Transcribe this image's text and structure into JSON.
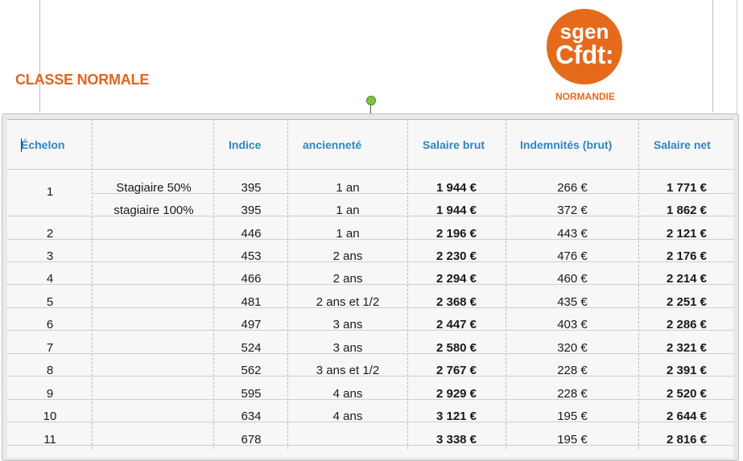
{
  "heading": "CLASSE NORMALE",
  "logo": {
    "line1": "sgen",
    "line2": "Cfdt:",
    "region": "NORMANDIE",
    "color": "#e56a1c"
  },
  "columns": [
    "Échelon",
    "",
    "Indice",
    "ancienneté",
    "Salaire brut",
    "Indemnités (brut)",
    "Salaire net"
  ],
  "rows": [
    {
      "echelon": "1",
      "note": "Stagiaire 50%",
      "indice": "395",
      "anciennete": "1 an",
      "brut": "1 944 €",
      "indemnites": "266 €",
      "net": "1 771 €"
    },
    {
      "echelon": "",
      "note": "stagiaire 100%",
      "indice": "395",
      "anciennete": "1 an",
      "brut": "1 944 €",
      "indemnites": "372 €",
      "net": "1 862 €"
    },
    {
      "echelon": "2",
      "note": "",
      "indice": "446",
      "anciennete": "1 an",
      "brut": "2 196 €",
      "indemnites": "443 €",
      "net": "2 121 €"
    },
    {
      "echelon": "3",
      "note": "",
      "indice": "453",
      "anciennete": "2 ans",
      "brut": "2 230 €",
      "indemnites": "476 €",
      "net": "2 176 €"
    },
    {
      "echelon": "4",
      "note": "",
      "indice": "466",
      "anciennete": "2 ans",
      "brut": "2 294 €",
      "indemnites": "460 €",
      "net": "2 214 €"
    },
    {
      "echelon": "5",
      "note": "",
      "indice": "481",
      "anciennete": "2 ans et 1/2",
      "brut": "2 368 €",
      "indemnites": "435 €",
      "net": "2 251 €"
    },
    {
      "echelon": "6",
      "note": "",
      "indice": "497",
      "anciennete": "3 ans",
      "brut": "2 447 €",
      "indemnites": "403 €",
      "net": "2 286 €"
    },
    {
      "echelon": "7",
      "note": "",
      "indice": "524",
      "anciennete": "3 ans",
      "brut": "2 580 €",
      "indemnites": "320 €",
      "net": "2 321 €"
    },
    {
      "echelon": "8",
      "note": "",
      "indice": "562",
      "anciennete": "3 ans et 1/2",
      "brut": "2 767 €",
      "indemnites": "228 €",
      "net": "2 391 €"
    },
    {
      "echelon": "9",
      "note": "",
      "indice": "595",
      "anciennete": "4 ans",
      "brut": "2 929 €",
      "indemnites": "228 €",
      "net": "2 520 €"
    },
    {
      "echelon": "10",
      "note": "",
      "indice": "634",
      "anciennete": "4 ans",
      "brut": "3 121 €",
      "indemnites": "195 €",
      "net": "2 644 €"
    },
    {
      "echelon": "11",
      "note": "",
      "indice": "678",
      "anciennete": "",
      "brut": "3 338 €",
      "indemnites": "195 €",
      "net": "2 816 €"
    }
  ]
}
